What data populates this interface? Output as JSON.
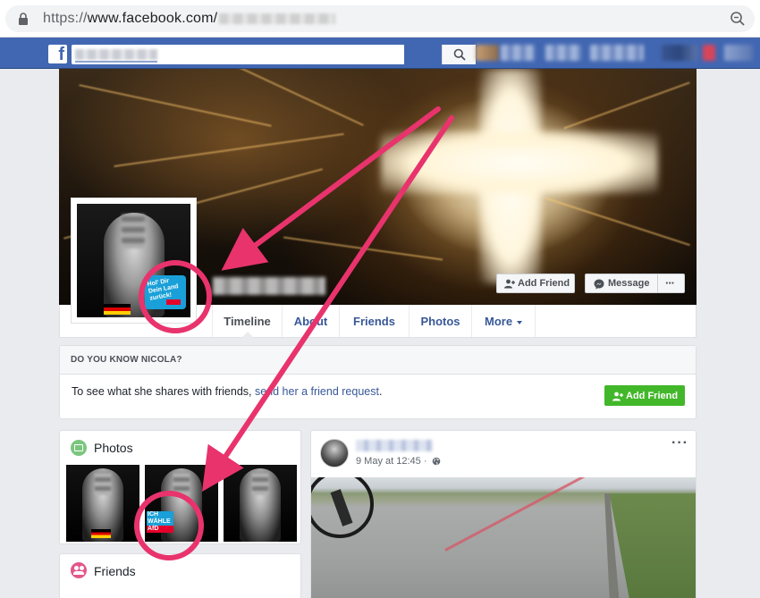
{
  "browser": {
    "url_scheme": "https://",
    "url_host": "www.facebook.com/"
  },
  "colors": {
    "facebook_blue": "#4267b2",
    "link_blue": "#385898",
    "green_button": "#42b72a",
    "annotation_pink": "#e8336d"
  },
  "icons": {
    "lock": "lock-icon",
    "zoom": "zoom-icon",
    "search": "search-icon",
    "add_friend": "add-person-icon",
    "message": "messenger-icon",
    "globe": "globe-icon"
  },
  "profile": {
    "badge_lines": [
      "Hol' Dir",
      "Dein Land",
      "zurück!"
    ],
    "add_friend_label": "Add Friend",
    "message_label": "Message",
    "more_label": "···"
  },
  "tabs": [
    {
      "label": "Timeline"
    },
    {
      "label": "About"
    },
    {
      "label": "Friends"
    },
    {
      "label": "Photos"
    },
    {
      "label": "More"
    }
  ],
  "do_you_know": {
    "heading": "DO YOU KNOW NICOLA?",
    "text_before": "To see what she shares with friends, ",
    "link_text": "send her a friend request",
    "text_after": ".",
    "button_label": "Add Friend"
  },
  "sidebar": {
    "photos_title": "Photos",
    "friends_title": "Friends",
    "photo_overlay_lines": [
      "ICH",
      "WÄHLE",
      "AfD"
    ]
  },
  "post": {
    "timestamp": "9 May at 12:45 ·",
    "menu": "···"
  }
}
